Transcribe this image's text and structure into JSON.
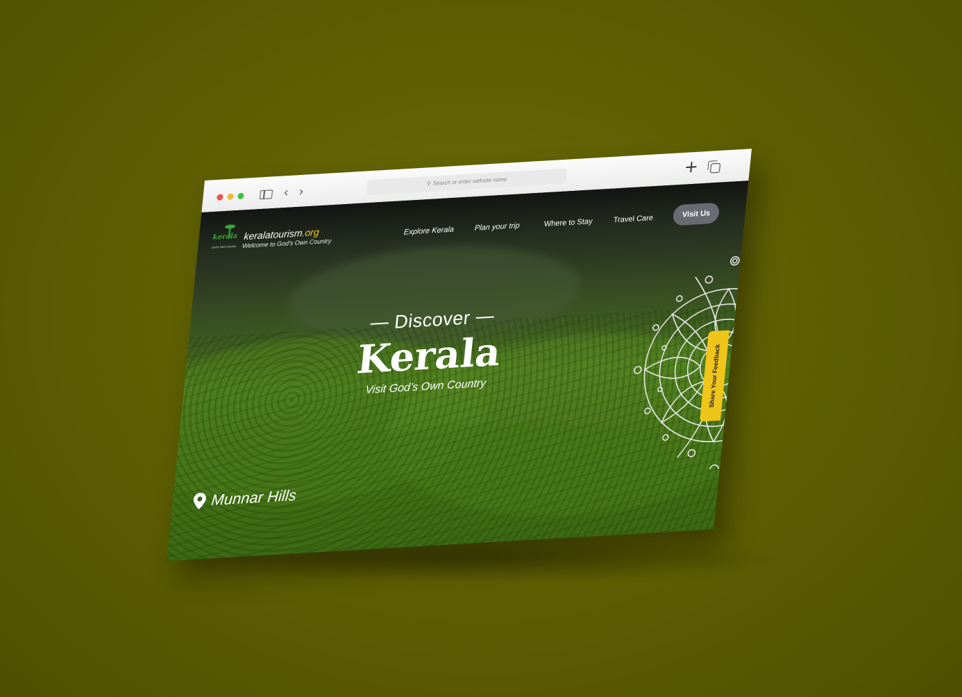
{
  "browser": {
    "url_placeholder": "Search or enter website name"
  },
  "site": {
    "logo_text": "kerala",
    "logo_subtitle": "God's Own Country",
    "name_main": "keralatourism",
    "name_tld": ".org",
    "tagline": "Welcome to God's Own Country"
  },
  "nav": {
    "items": [
      {
        "label": "Explore Kerala"
      },
      {
        "label": "Plan your trip"
      },
      {
        "label": "Where to Stay"
      },
      {
        "label": "Travel Care"
      }
    ],
    "cta_label": "Visit Us"
  },
  "hero": {
    "pre_title": "Discover",
    "title": "Kerala",
    "subtitle": "Visit God’s Own Country"
  },
  "location": {
    "name": "Munnar Hills",
    "icon": "map-pin-icon"
  },
  "feedback": {
    "label": "Share Your Feedback"
  },
  "colors": {
    "background": "#5c5d02",
    "accent_yellow": "#f0c51a",
    "cta_bg": "#6a6a72"
  }
}
